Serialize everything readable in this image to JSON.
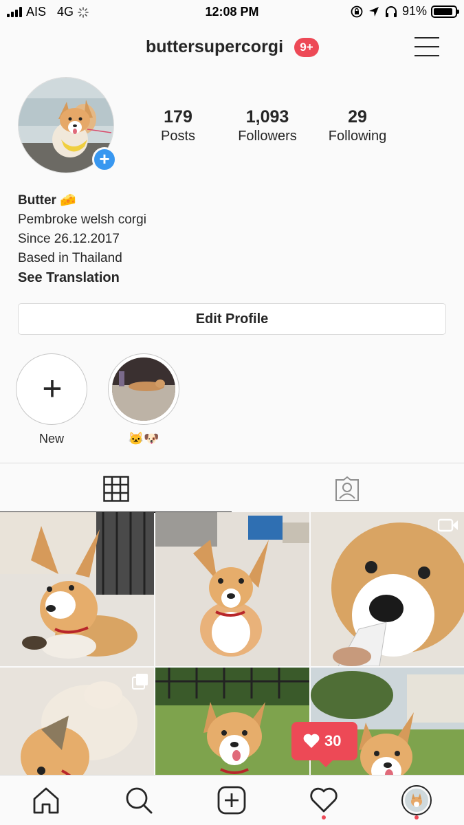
{
  "status_bar": {
    "carrier": "AIS",
    "network": "4G",
    "time": "12:08 PM",
    "battery": "91%",
    "battery_level": 0.91
  },
  "header": {
    "username": "buttersupercorgi",
    "notification_badge": "9+"
  },
  "stats": [
    {
      "value": "179",
      "label": "Posts"
    },
    {
      "value": "1,093",
      "label": "Followers"
    },
    {
      "value": "29",
      "label": "Following"
    }
  ],
  "bio": {
    "name": "Butter 🧀",
    "lines": [
      "Pembroke welsh corgi",
      "Since 26.12.2017",
      "Based in Thailand"
    ],
    "see_translation": "See Translation"
  },
  "edit_profile_label": "Edit Profile",
  "highlights": [
    {
      "label": "New"
    },
    {
      "label": "🐱🐶"
    }
  ],
  "activity_popup": {
    "likes": "30"
  },
  "colors": {
    "accent_blue": "#3897f0",
    "badge_red": "#ed4956",
    "text": "#262626",
    "border": "#dbdbdb"
  }
}
